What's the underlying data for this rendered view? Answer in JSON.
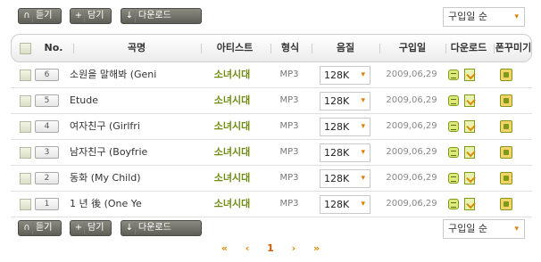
{
  "toolbar": {
    "listen_label": "듣기",
    "add_label": "담기",
    "download_label": "다운로드",
    "sort_value": "구입일 순"
  },
  "table": {
    "headers": {
      "no": "No.",
      "title": "곡명",
      "artist": "아티스트",
      "format": "형식",
      "quality": "음질",
      "date": "구입일",
      "download": "다운로드",
      "phone": "폰꾸미기"
    },
    "rows": [
      {
        "no": "6",
        "title": "소원을 말해봐 (Geni",
        "artist": "소녀시대",
        "format": "MP3",
        "quality": "128K",
        "date": "2009,06,29"
      },
      {
        "no": "5",
        "title": "Etude",
        "artist": "소녀시대",
        "format": "MP3",
        "quality": "128K",
        "date": "2009,06,29"
      },
      {
        "no": "4",
        "title": "여자친구 (Girlfri",
        "artist": "소녀시대",
        "format": "MP3",
        "quality": "128K",
        "date": "2009,06,29"
      },
      {
        "no": "3",
        "title": "남자친구 (Boyfrie",
        "artist": "소녀시대",
        "format": "MP3",
        "quality": "128K",
        "date": "2009,06,29"
      },
      {
        "no": "2",
        "title": "동화 (My Child)",
        "artist": "소녀시대",
        "format": "MP3",
        "quality": "128K",
        "date": "2009,06,29"
      },
      {
        "no": "1",
        "title": "1 년 後 (One Ye",
        "artist": "소녀시대",
        "format": "MP3",
        "quality": "128K",
        "date": "2009,06,29"
      }
    ]
  },
  "pagination": {
    "first": "«",
    "prev": "‹",
    "current": "1",
    "next": "›",
    "last": "»"
  },
  "colors": {
    "artist": "#6e8c12",
    "accent": "#e07b00",
    "button_bg": "#6a6a62"
  }
}
